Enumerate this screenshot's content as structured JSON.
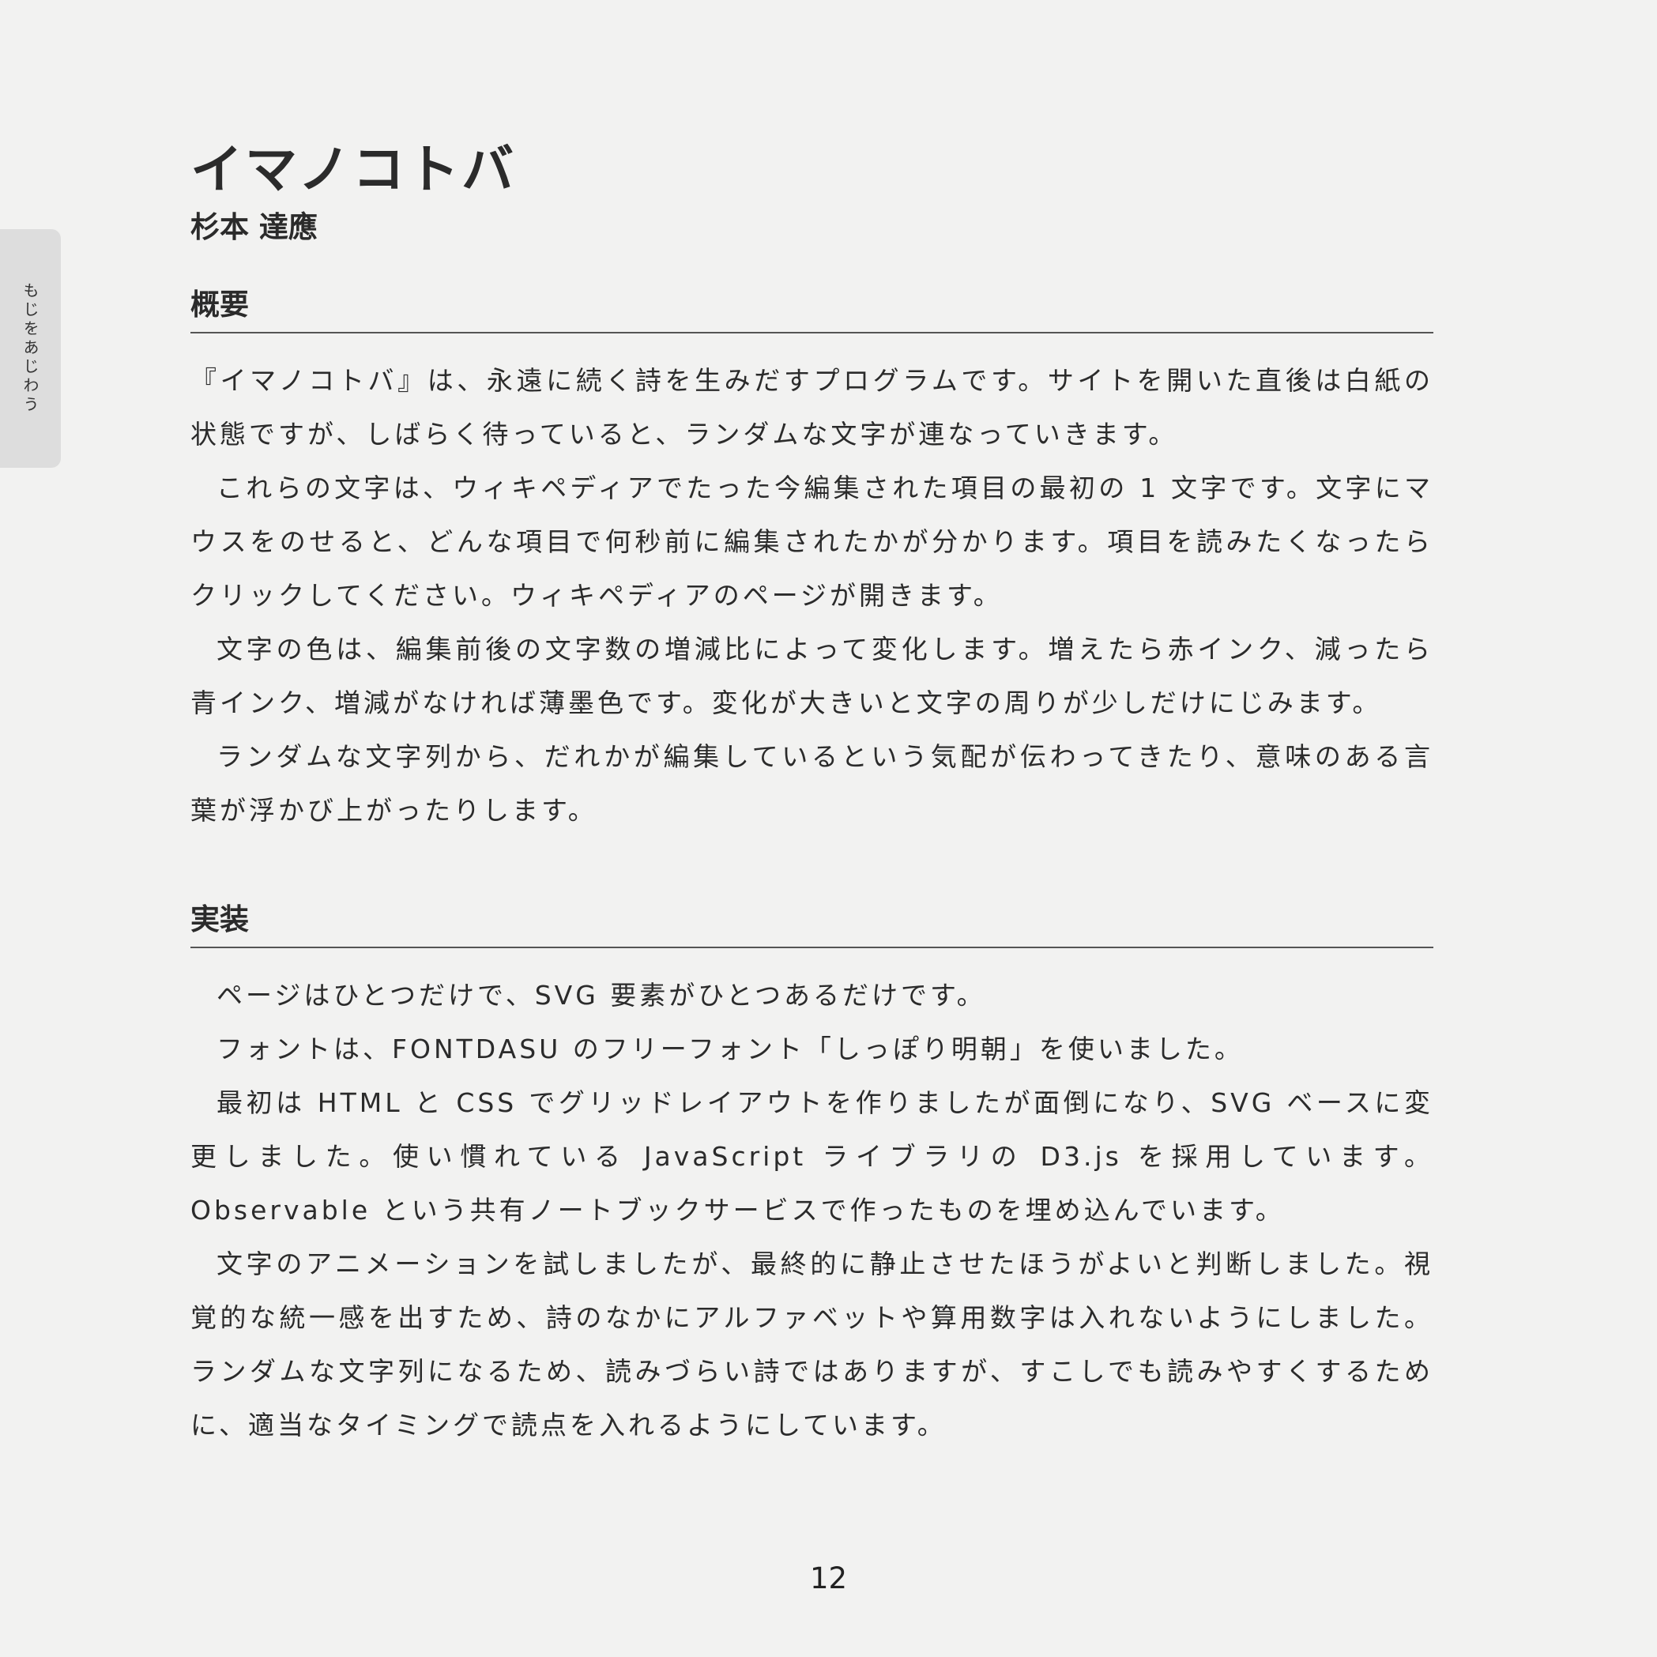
{
  "side_tab": {
    "label": "もじをあじわう"
  },
  "title": "イマノコトバ",
  "author": "杉本 達應",
  "sections": [
    {
      "heading": "概要",
      "paragraphs": [
        "『イマノコトバ』は、永遠に続く詩を生みだすプログラムです。サイトを開いた直後は白紙の状態ですが、しばらく待っていると、ランダムな文字が連なっていきます。",
        "これらの文字は、ウィキペディアでたった今編集された項目の最初の 1 文字です。文字にマウスをのせると、どんな項目で何秒前に編集されたかが分かります。項目を読みたくなったらクリックしてください。ウィキペディアのページが開きます。",
        "文字の色は、編集前後の文字数の増減比によって変化します。増えたら赤インク、減ったら青インク、増減がなければ薄墨色です。変化が大きいと文字の周りが少しだけにじみます。",
        "ランダムな文字列から、だれかが編集しているという気配が伝わってきたり、意味のある言葉が浮かび上がったりします。"
      ]
    },
    {
      "heading": "実装",
      "paragraphs": [
        "ページはひとつだけで、SVG 要素がひとつあるだけです。",
        "フォントは、FONTDASU のフリーフォント「しっぽり明朝」を使いました。",
        "最初は HTML と CSS でグリッドレイアウトを作りましたが面倒になり、SVG ベースに変更しました。使い慣れている JavaScript ライブラリの D3.js を採用しています。Observable という共有ノートブックサービスで作ったものを埋め込んでいます。",
        "文字のアニメーションを試しましたが、最終的に静止させたほうがよいと判断しました。視覚的な統一感を出すため、詩のなかにアルファベットや算用数字は入れないようにしました。ランダムな文字列になるため、読みづらい詩ではありますが、すこしでも読みやすくするために、適当なタイミングで読点を入れるようにしています。"
      ]
    }
  ],
  "page_number": "12"
}
